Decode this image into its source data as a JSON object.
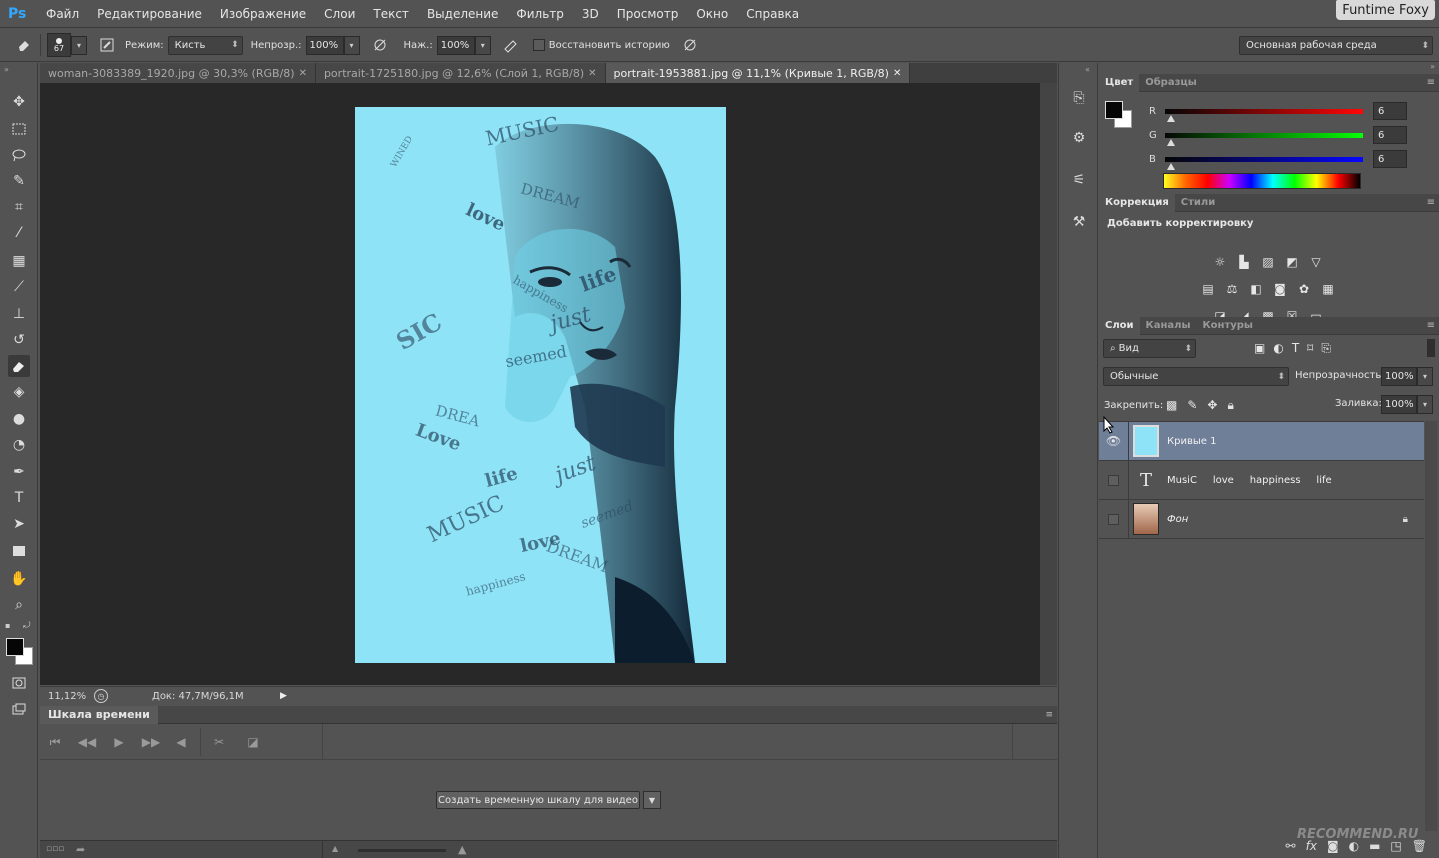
{
  "app": {
    "logo": "Ps",
    "corner_title": "Funtime Foxy"
  },
  "menu": [
    "Файл",
    "Редактирование",
    "Изображение",
    "Слои",
    "Текст",
    "Выделение",
    "Фильтр",
    "3D",
    "Просмотр",
    "Окно",
    "Справка"
  ],
  "options": {
    "brush_size": "67",
    "mode_label": "Режим:",
    "mode_value": "Кисть",
    "opacity_label": "Непрозр.:",
    "opacity_value": "100%",
    "pressure_label": "Наж.:",
    "pressure_value": "100%",
    "restore_history": "Восстановить историю",
    "workspace": "Основная рабочая среда"
  },
  "tabs": [
    {
      "label": "woman-3083389_1920.jpg @ 30,3% (RGB/8)",
      "active": false
    },
    {
      "label": "portrait-1725180.jpg @ 12,6% (Слой 1, RGB/8)",
      "active": false
    },
    {
      "label": "portrait-1953881.jpg @ 11,1% (Кривые 1, RGB/8)",
      "active": true
    }
  ],
  "artwork_words": [
    "MUSIC",
    "love",
    "life",
    "DREAM",
    "just",
    "happiness",
    "seemed",
    "WINED",
    "SIC",
    "Love",
    "DREA",
    "MUSIC",
    "life",
    "just",
    "DREAM",
    "happiness",
    "love",
    "seemed"
  ],
  "status": {
    "zoom": "11,12%",
    "doc": "Док: 47,7M/96,1M"
  },
  "timeline": {
    "tab": "Шкала времени",
    "create_button": "Создать временную шкалу для видео"
  },
  "color_panel": {
    "tabs": [
      "Цвет",
      "Образцы"
    ],
    "channels": [
      {
        "label": "R",
        "value": "6",
        "color": "#ff0000"
      },
      {
        "label": "G",
        "value": "6",
        "color": "#00c000"
      },
      {
        "label": "B",
        "value": "6",
        "color": "#0000ff"
      }
    ]
  },
  "adjustments": {
    "tabs": [
      "Коррекция",
      "Стили"
    ],
    "title": "Добавить корректировку"
  },
  "layers_panel": {
    "tabs": [
      "Слои",
      "Каналы",
      "Контуры"
    ],
    "filter": "Вид",
    "blend_mode": "Обычные",
    "opacity_label": "Непрозрачность:",
    "opacity_value": "100%",
    "lock_label": "Закрепить:",
    "fill_label": "Заливка:",
    "fill_value": "100%",
    "layers": [
      {
        "name": "Кривые 1",
        "selected": true,
        "visible": true
      },
      {
        "name": "MusiC     love     happiness     life",
        "selected": false,
        "visible": false
      },
      {
        "name": "Фон",
        "selected": false,
        "visible": false
      }
    ]
  },
  "watermark": "RECOMMEND.RU"
}
